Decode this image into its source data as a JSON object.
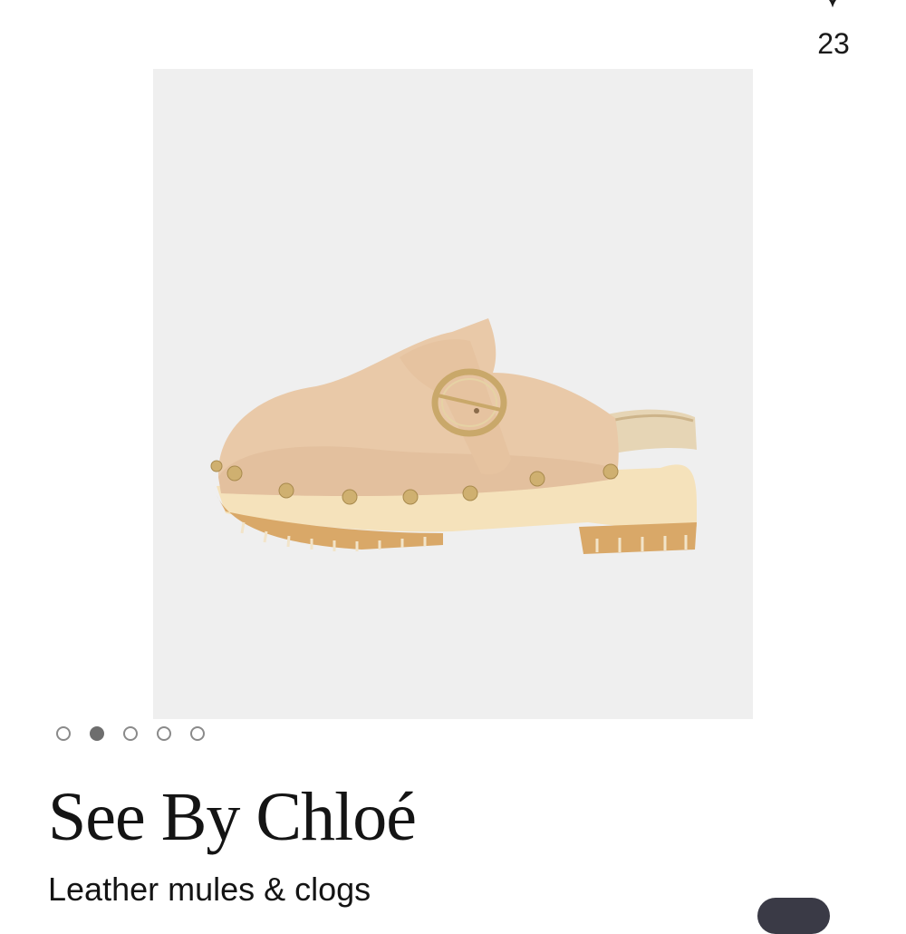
{
  "listing": {
    "likes": "23",
    "brand": "See By Chloé",
    "category": "Leather mules & clogs"
  },
  "gallery": {
    "image_count": 5,
    "active_index": 1,
    "image_subject": "shoe"
  },
  "colors": {
    "photo_background": "#efefef",
    "suede": "#e9c9a8",
    "wood_sole": "#f5e2bb",
    "tread": "#d9a868",
    "stud": "#cfb070",
    "dot_active": "#6e6e6e"
  }
}
